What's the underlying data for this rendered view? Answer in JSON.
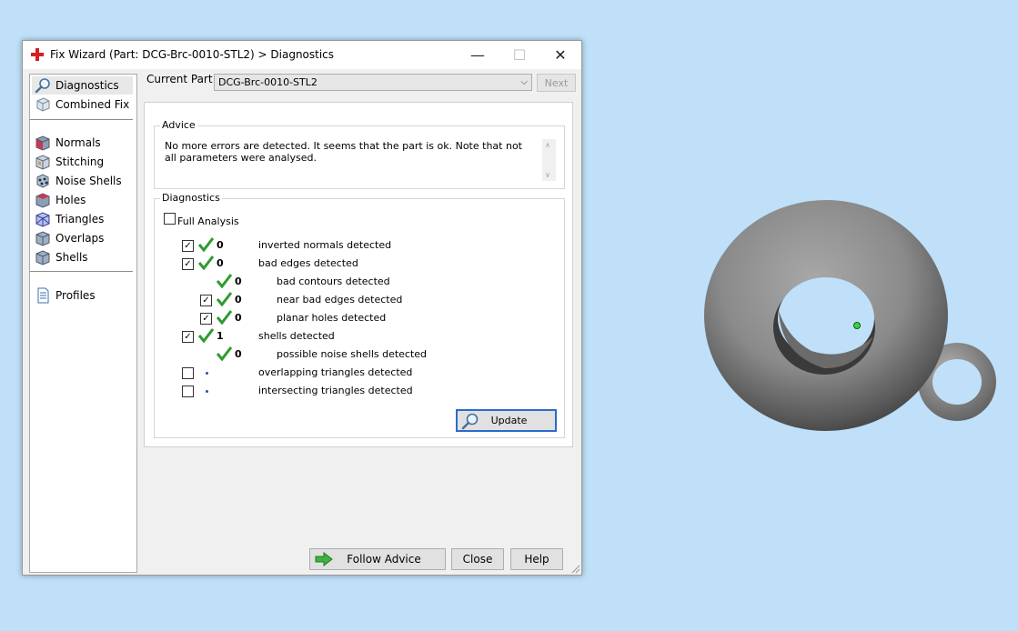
{
  "window": {
    "title": "Fix Wizard (Part: DCG-Brc-0010-STL2) > Diagnostics",
    "minimize_icon": "—",
    "maximize_icon": "☐",
    "close_icon": "✕"
  },
  "sidebar": {
    "items": [
      {
        "label": "Diagnostics",
        "icon": "magnifier-icon",
        "selected": true
      },
      {
        "label": "Combined Fix",
        "icon": "combined-fix-icon"
      },
      {
        "label": "Normals",
        "icon": "normals-icon"
      },
      {
        "label": "Stitching",
        "icon": "stitching-icon"
      },
      {
        "label": "Noise Shells",
        "icon": "noise-shells-icon"
      },
      {
        "label": "Holes",
        "icon": "holes-icon"
      },
      {
        "label": "Triangles",
        "icon": "triangles-icon"
      },
      {
        "label": "Overlaps",
        "icon": "overlaps-icon"
      },
      {
        "label": "Shells",
        "icon": "shells-icon"
      },
      {
        "label": "Profiles",
        "icon": "profiles-icon"
      }
    ]
  },
  "part": {
    "label": "Current Part:",
    "value": "DCG-Brc-0010-STL2",
    "next_label": "Next"
  },
  "advice": {
    "title": "Advice",
    "text": "No more errors are detected. It seems that the part is ok. Note that not all parameters were analysed.",
    "scroll_up": "∧",
    "scroll_down": "∨"
  },
  "diagnostics": {
    "title": "Diagnostics",
    "full_analysis_label": "Full Analysis",
    "full_analysis_checked": false,
    "check_mark": "✓",
    "rows": [
      {
        "checked": true,
        "status": "ok",
        "count": "0",
        "label": "inverted normals detected"
      },
      {
        "checked": true,
        "status": "ok",
        "count": "0",
        "label": "bad edges detected"
      },
      {
        "checked": null,
        "status": "ok",
        "count": "0",
        "label": "bad contours detected"
      },
      {
        "checked": true,
        "status": "ok",
        "count": "0",
        "label": "near bad edges detected"
      },
      {
        "checked": true,
        "status": "ok",
        "count": "0",
        "label": "planar holes detected"
      },
      {
        "checked": true,
        "status": "ok",
        "count": "1",
        "label": "shells detected"
      },
      {
        "checked": null,
        "status": "ok",
        "count": "0",
        "label": "possible noise shells detected"
      },
      {
        "checked": false,
        "status": "unknown",
        "count": "",
        "label": "overlapping triangles detected"
      },
      {
        "checked": false,
        "status": "unknown",
        "count": "",
        "label": "intersecting triangles detected"
      }
    ],
    "update_label": "Update"
  },
  "buttons": {
    "follow_advice": "Follow Advice",
    "close": "Close",
    "help": "Help"
  },
  "colors": {
    "viewport_bg": "#bfe0f8",
    "ok_green": "#2e9b2e",
    "accent_blue": "#2b6bcb"
  }
}
